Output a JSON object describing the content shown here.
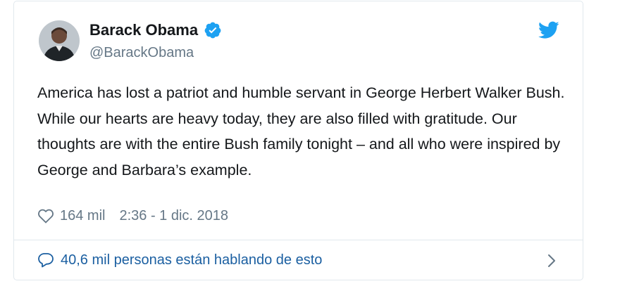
{
  "tweet": {
    "author": {
      "name": "Barack Obama",
      "handle": "@BarackObama",
      "verified": true,
      "avatar_icon": "person-avatar"
    },
    "text": "America has lost a patriot and humble servant in George Herbert Walker Bush. While our hearts are heavy today, they are also filled with gratitude. Our thoughts are with the entire Bush family tonight – and all who were inspired by George and Barbara’s example.",
    "likes": "164 mil",
    "timestamp": "2:36 - 1 dic. 2018",
    "conversation_label": "40,6 mil personas están hablando de esto"
  },
  "icons": {
    "verified": "verified-badge-icon",
    "brand": "twitter-bird-icon",
    "like": "heart-icon",
    "reply": "comment-icon",
    "chevron": "chevron-right-icon"
  },
  "colors": {
    "text": "#14171a",
    "secondary": "#657786",
    "link": "#1b5fa1",
    "twitter_blue": "#1da1f2",
    "border": "#e1e8ed"
  }
}
